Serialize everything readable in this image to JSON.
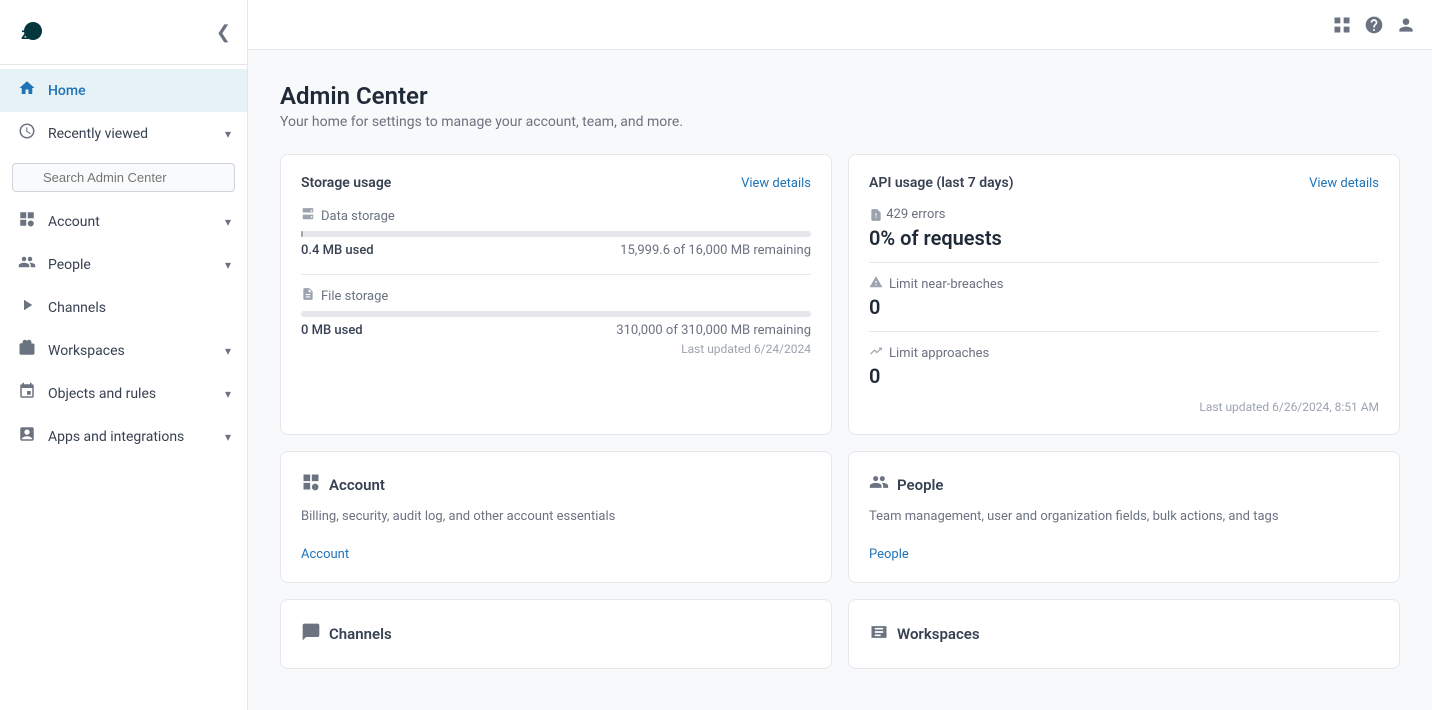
{
  "sidebar": {
    "logo_alt": "Zendesk",
    "collapse_icon": "❮",
    "recently_viewed_label": "Recently viewed",
    "search_placeholder": "Search Admin Center",
    "nav_items": [
      {
        "id": "home",
        "label": "Home",
        "icon": "⌂",
        "active": true,
        "has_chevron": false
      },
      {
        "id": "recently-viewed",
        "label": "Recently viewed",
        "icon": "🕐",
        "active": false,
        "has_chevron": true
      },
      {
        "id": "account",
        "label": "Account",
        "icon": "⊞",
        "active": false,
        "has_chevron": true
      },
      {
        "id": "people",
        "label": "People",
        "icon": "👥",
        "active": false,
        "has_chevron": true
      },
      {
        "id": "channels",
        "label": "Channels",
        "icon": "⇄",
        "active": false,
        "has_chevron": false
      },
      {
        "id": "workspaces",
        "label": "Workspaces",
        "icon": "▭",
        "active": false,
        "has_chevron": true
      },
      {
        "id": "objects-and-rules",
        "label": "Objects and rules",
        "icon": "◎",
        "active": false,
        "has_chevron": true
      },
      {
        "id": "apps-and-integrations",
        "label": "Apps and integrations",
        "icon": "⊕",
        "active": false,
        "has_chevron": true
      }
    ]
  },
  "topbar": {
    "grid_icon": "⊞",
    "help_icon": "?",
    "user_icon": "👤"
  },
  "main": {
    "title": "Admin Center",
    "subtitle": "Your home for settings to manage your account, team, and more.",
    "storage_card": {
      "title": "Storage usage",
      "view_details": "View details",
      "items": [
        {
          "label": "Data storage",
          "icon": "🗄",
          "used_label": "0.4 MB used",
          "remaining_label": "15,999.6 of 16,000 MB remaining",
          "progress_pct": 0.003,
          "updated": ""
        },
        {
          "label": "File storage",
          "icon": "📄",
          "used_label": "0 MB used",
          "remaining_label": "310,000 of 310,000 MB remaining",
          "progress_pct": 0,
          "updated": "Last updated 6/24/2024"
        }
      ]
    },
    "api_card": {
      "title": "API usage (last 7 days)",
      "view_details": "View details",
      "errors_label": "429 errors",
      "requests_label": "0% of requests",
      "near_breaches_label": "Limit near-breaches",
      "near_breaches_value": "0",
      "approaches_label": "Limit approaches",
      "approaches_value": "0",
      "updated": "Last updated 6/26/2024, 8:51 AM"
    },
    "info_cards": [
      {
        "id": "account",
        "icon": "⊞",
        "title": "Account",
        "desc": "Billing, security, audit log, and other account essentials",
        "link_label": "Account"
      },
      {
        "id": "people",
        "icon": "👥",
        "title": "People",
        "desc": "Team management, user and organization fields, bulk actions, and tags",
        "link_label": "People"
      }
    ],
    "bottom_cards": [
      {
        "id": "channels",
        "icon": "⇄",
        "title": "Channels"
      },
      {
        "id": "workspaces",
        "icon": "▭",
        "title": "Workspaces"
      }
    ]
  }
}
